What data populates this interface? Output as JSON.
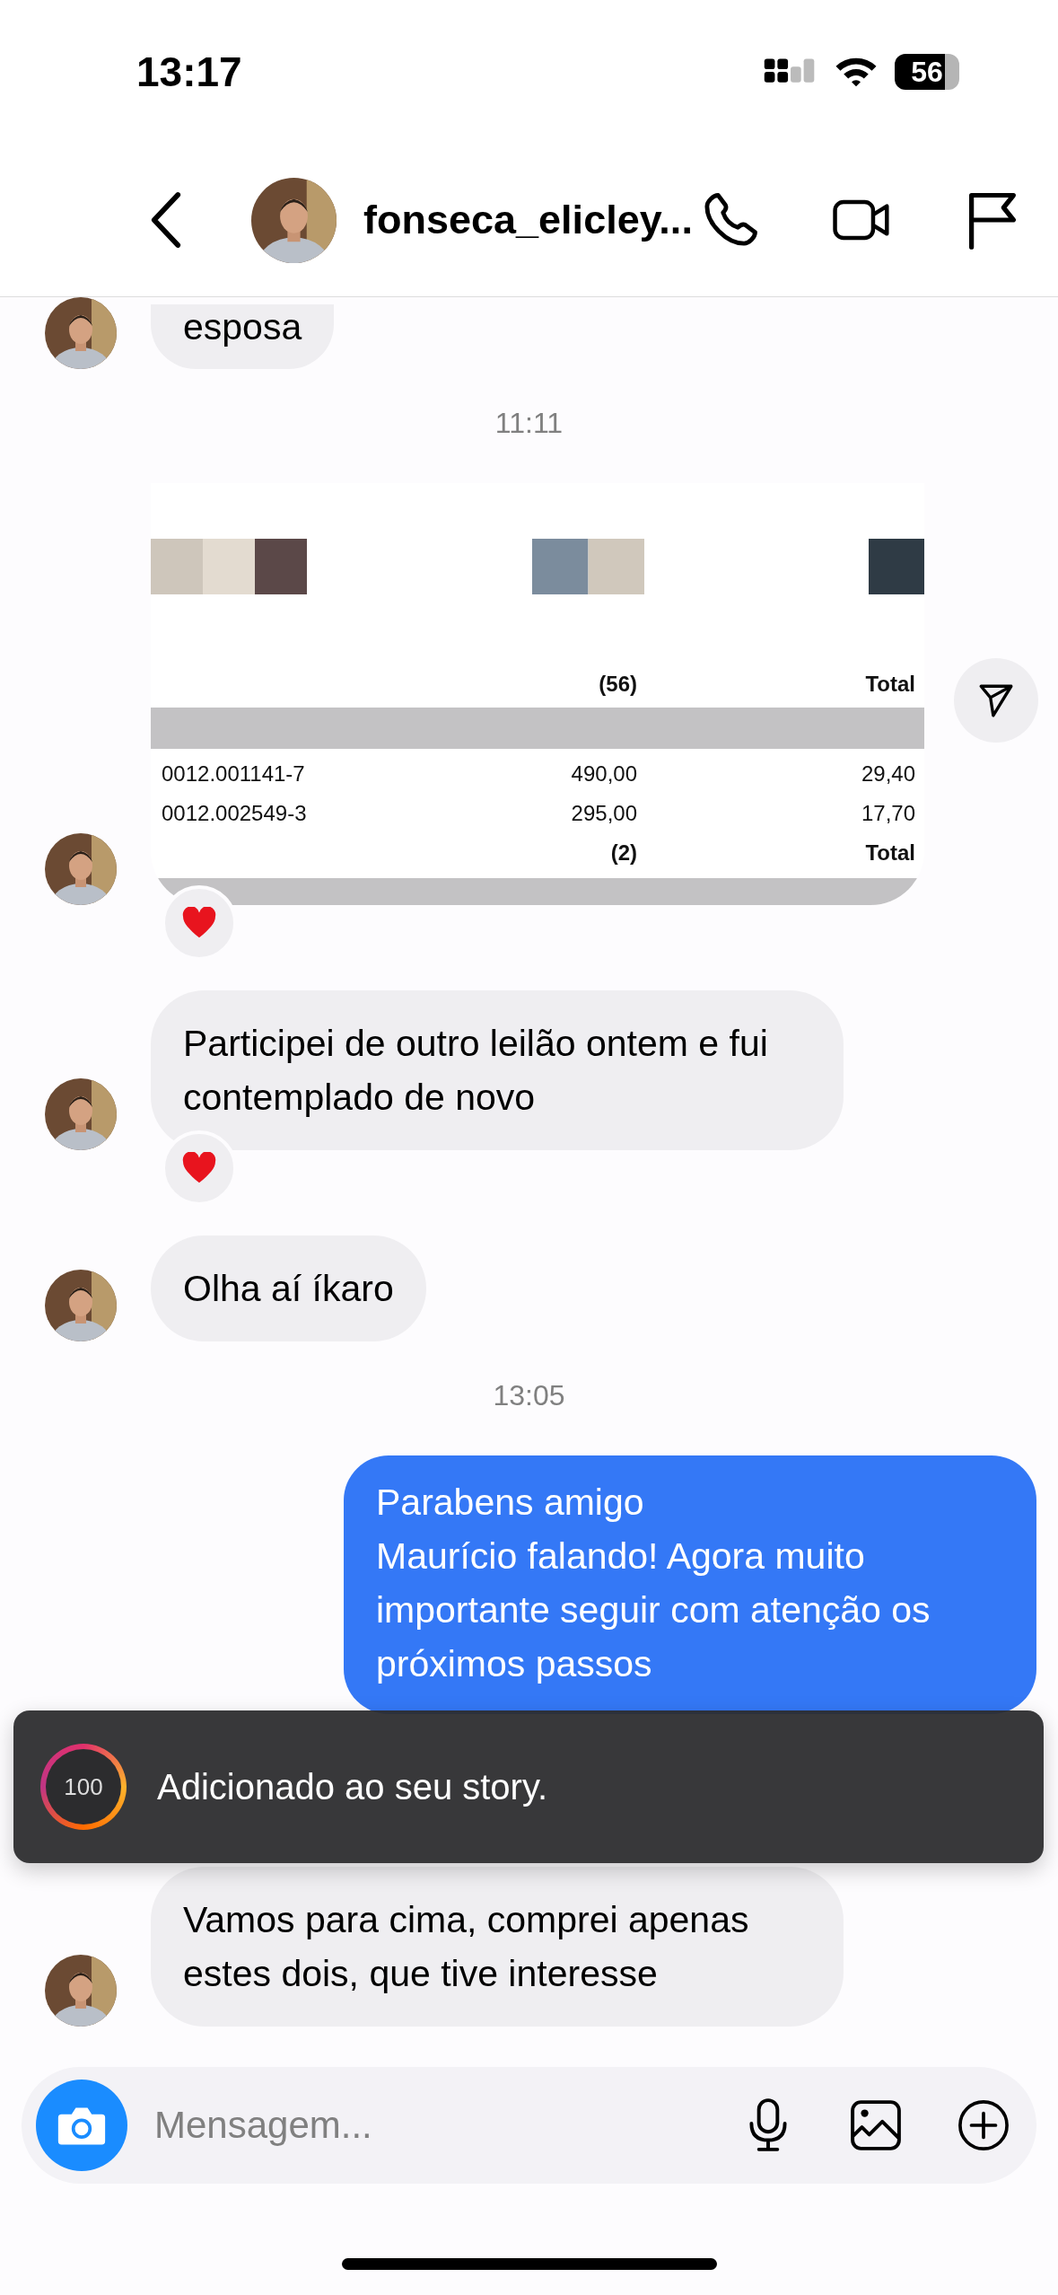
{
  "status_bar": {
    "time": "13:17",
    "battery": "56"
  },
  "header": {
    "username": "fonseca_elicley..."
  },
  "messages": [
    {
      "kind": "text",
      "outgoing": false,
      "reaction": false,
      "text": "esposa"
    },
    {
      "kind": "time",
      "text": "11:11"
    },
    {
      "kind": "image",
      "outgoing": false,
      "reaction": true,
      "share": true,
      "rows": [
        {
          "kind": "swatches"
        },
        {
          "kind": "total",
          "count": "(56)",
          "label": "Total"
        },
        {
          "kind": "band"
        },
        {
          "kind": "item",
          "code": "0012.001141-7",
          "value": "490,00",
          "tax": "29,40"
        },
        {
          "kind": "item",
          "code": "0012.002549-3",
          "value": "295,00",
          "tax": "17,70"
        },
        {
          "kind": "total",
          "count": "(2)",
          "label": "Total"
        }
      ]
    },
    {
      "kind": "text",
      "outgoing": false,
      "reaction": true,
      "text": "Participei de outro leilão ontem e fui contemplado de novo"
    },
    {
      "kind": "text",
      "outgoing": false,
      "reaction": false,
      "text": "Olha aí íkaro"
    },
    {
      "kind": "time",
      "text": "13:05"
    },
    {
      "kind": "text",
      "outgoing": true,
      "reaction": false,
      "text": "Parabens amigo\nMaurício falando! Agora muito importante seguir com atenção os próximos passos"
    },
    {
      "kind": "text",
      "outgoing": false,
      "reaction": false,
      "text": "Vamos para cima, comprei apenas estes dois, que tive interesse"
    }
  ],
  "toast": {
    "progress": "100",
    "text": "Adicionado ao seu story."
  },
  "composer": {
    "placeholder": "Mensagem..."
  }
}
